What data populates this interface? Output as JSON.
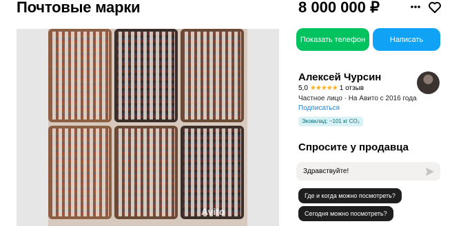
{
  "listing": {
    "title": "Почтовые марки",
    "price": "8 000 000 ₽"
  },
  "header_icons": [
    "more-vertical-icon",
    "heart-icon"
  ],
  "gallery": {
    "watermark": "Avito"
  },
  "actions": {
    "show_phone_label": "Показать телефон",
    "write_label": "Написать",
    "colors": {
      "show_phone": "#00c25f",
      "write": "#10a3f5"
    }
  },
  "seller": {
    "name": "Алексей Чурсин",
    "rating": "5,0",
    "stars": "★★★★★",
    "reviews": "1 отзыв",
    "meta": "Частное лицо · На Авито с 2016 года",
    "subscribe_label": "Подписаться",
    "eco_badge": "Эковклад: ~101 кг CO₂"
  },
  "ask": {
    "title": "Спросите у продавца",
    "input_value": "Здравствуйте!",
    "quick_questions": [
      "Где и когда можно посмотреть?",
      "Сегодня можно посмотреть?"
    ]
  }
}
